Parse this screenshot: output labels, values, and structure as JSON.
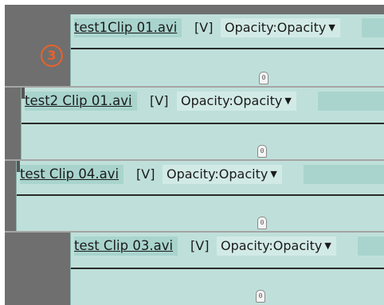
{
  "annotation": {
    "number": "3",
    "color": "#e8622a"
  },
  "clips": [
    {
      "name": "test1Clip 01.avi",
      "type": "[V]",
      "property": "Opacity:Opacity",
      "keyframe": "0"
    },
    {
      "name": "test2 Clip 01.avi",
      "type": "[V]",
      "property": "Opacity:Opacity",
      "keyframe": "0"
    },
    {
      "name": "test Clip 04.avi",
      "type": "[V]",
      "property": "Opacity:Opacity",
      "keyframe": "0"
    },
    {
      "name": "test Clip 03.avi",
      "type": "[V]",
      "property": "Opacity:Opacity",
      "keyframe": "0"
    }
  ],
  "icons": {
    "dropdown": "chevron-down-icon",
    "keyframe": "keyframe-handle-icon"
  },
  "colors": {
    "clip_fill": "#bfe0da",
    "track_bg": "#6f6f6f",
    "rubber_band": "#2a2a2a"
  }
}
